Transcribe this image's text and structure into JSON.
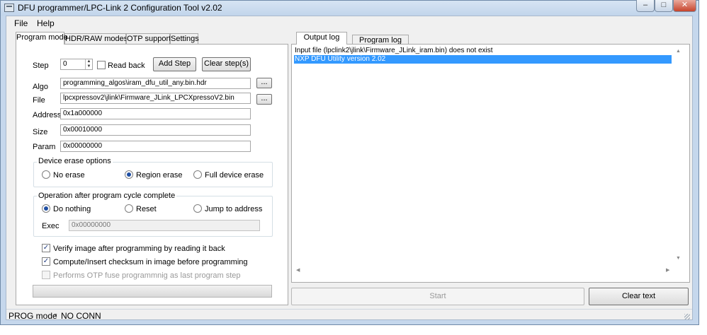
{
  "window": {
    "title": "DFU programmer/LPC-Link 2 Configuration Tool v2.02"
  },
  "window_buttons": {
    "minimize": "–",
    "maximize": "□",
    "close": "✕"
  },
  "menu": [
    "File",
    "Help"
  ],
  "left_tabs": [
    "Program mode",
    "HDR/RAW modes",
    "OTP support",
    "Settings"
  ],
  "program": {
    "step_label": "Step",
    "step_value": "0",
    "readback_label": "Read back",
    "add_step": "Add Step",
    "clear_steps": "Clear step(s)",
    "algo_label": "Algo",
    "algo_value": "programming_algos\\iram_dfu_util_any.bin.hdr",
    "file_label": "File",
    "file_value": "lpcxpressov2\\jlink\\Firmware_JLink_LPCXpressoV2.bin",
    "browse": "...",
    "address_label": "Address",
    "address_value": "0x1a000000",
    "size_label": "Size",
    "size_value": "0x00010000",
    "param_label": "Param",
    "param_value": "0x00000000"
  },
  "erase": {
    "title": "Device erase options",
    "options": [
      "No erase",
      "Region erase",
      "Full device erase"
    ],
    "selected": "Region erase"
  },
  "after": {
    "title": "Operation after program cycle complete",
    "options": [
      "Do nothing",
      "Reset",
      "Jump to address"
    ],
    "selected": "Do nothing",
    "exec_label": "Exec",
    "exec_value": "0x00000000"
  },
  "checks": [
    {
      "label": "Verify image after programming by reading it back",
      "checked": true,
      "enabled": true
    },
    {
      "label": "Compute/Insert checksum in image before programming",
      "checked": true,
      "enabled": true
    },
    {
      "label": "Performs OTP fuse programmnig as last program step",
      "checked": false,
      "enabled": false
    }
  ],
  "right_tabs": [
    "Output log",
    "Program log"
  ],
  "log": [
    {
      "text": "Input file (lpclink2\\jlink\\Firmware_JLink_iram.bin) does not exist",
      "selected": false
    },
    {
      "text": "NXP DFU Utility version 2.02",
      "selected": true
    }
  ],
  "buttons": {
    "start": "Start",
    "clear_text": "Clear text"
  },
  "status": {
    "mode": "PROG mode",
    "connection": "NO CONN"
  },
  "icons": {
    "check": "✓",
    "scroll_up": "▲",
    "scroll_down": "▼",
    "scroll_left": "◀",
    "scroll_right": "▶",
    "dropdown": "▼"
  }
}
